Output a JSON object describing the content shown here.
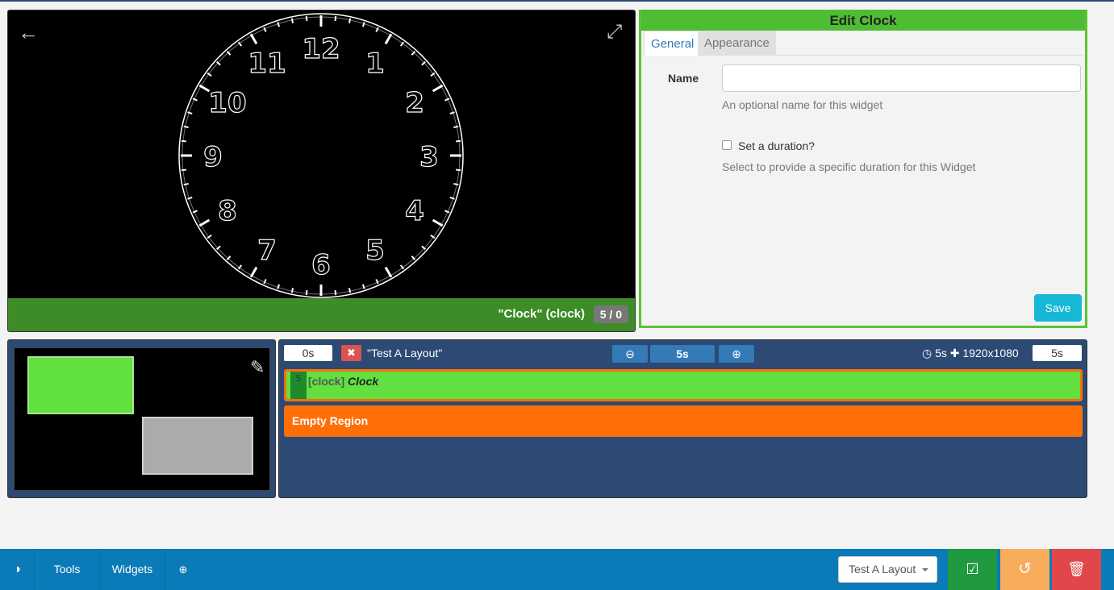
{
  "viewer": {
    "widget_label": "\"Clock\" (clock)",
    "badge": "5 / 0",
    "clock_numbers": [
      "12",
      "1",
      "2",
      "3",
      "4",
      "5",
      "6",
      "7",
      "8",
      "9",
      "10",
      "11"
    ],
    "icons": {
      "back": "arrow-left-icon",
      "fullscreen": "expand-icon"
    }
  },
  "edit_panel": {
    "title": "Edit Clock",
    "tabs": [
      {
        "label": "General",
        "active": true
      },
      {
        "label": "Appearance",
        "active": false
      }
    ],
    "name_label": "Name",
    "name_value": "",
    "name_help": "An optional name for this widget",
    "duration_checkbox_label": "Set a duration?",
    "duration_checked": false,
    "duration_help": "Select to provide a specific duration for this Widget",
    "save_label": "Save"
  },
  "timeline": {
    "start": "0s",
    "layout_name": "\"Test A Layout\"",
    "scale": "5s",
    "info": "5s",
    "resolution": "1920x1080",
    "end": "5s",
    "regions": [
      {
        "duration": "5",
        "type": "[clock]",
        "widget": "Clock"
      },
      {
        "label": "Empty Region"
      }
    ]
  },
  "bottom_bar": {
    "tools_label": "Tools",
    "widgets_label": "Widgets",
    "layout_select": "Test A Layout",
    "icons": {
      "toggle": "toggle-icon",
      "zoom": "zoom-icon",
      "publish": "check-square-icon",
      "revert": "undo-icon",
      "delete": "trash-icon"
    }
  },
  "colors": {
    "panel_green": "#4fbd33",
    "viewer_footer": "#3d8c27",
    "timeline_bg": "#2c4a73",
    "region_orange": "#ff6f08",
    "widget_green": "#61e03f",
    "bottom_bar": "#0b7ab8",
    "save_button": "#17b7d6",
    "publish": "#1f9a3f",
    "revert": "#f8ad5c",
    "delete": "#e1474a"
  }
}
